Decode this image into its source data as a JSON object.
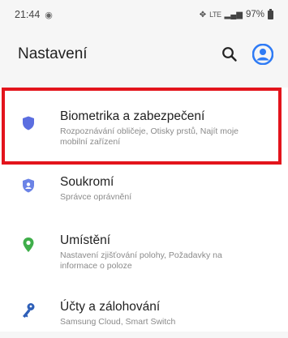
{
  "status": {
    "time": "21:44",
    "network": "LTE",
    "battery": "97%"
  },
  "header": {
    "title": "Nastavení"
  },
  "colors": {
    "highlight": "#e3141c",
    "shield_accent": "#5b6ee0",
    "location_accent": "#3fae4a",
    "key_accent": "#2e5fb8",
    "profile_accent": "#2f7bf5"
  },
  "items": [
    {
      "title": "Biometrika a zabezpečení",
      "subtitle": "Rozpoznávání obličeje, Otisky prstů, Najít moje mobilní zařízení",
      "icon": "shield-icon"
    },
    {
      "title": "Soukromí",
      "subtitle": "Správce oprávnění",
      "icon": "privacy-shield-icon"
    },
    {
      "title": "Umístění",
      "subtitle": "Nastavení zjišťování polohy, Požadavky na informace o poloze",
      "icon": "location-pin-icon"
    },
    {
      "title": "Účty a zálohování",
      "subtitle": "Samsung Cloud, Smart Switch",
      "icon": "key-icon"
    }
  ]
}
